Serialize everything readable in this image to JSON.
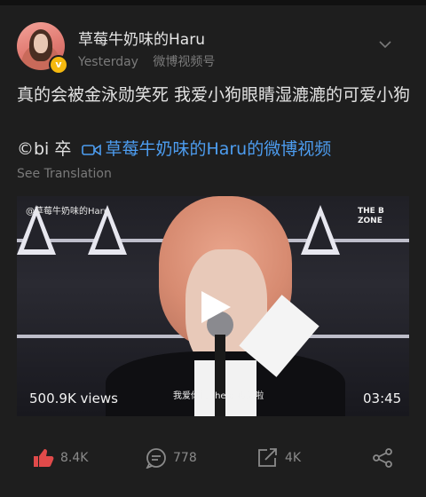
{
  "post": {
    "username": "草莓牛奶味的Haru",
    "time": "Yesterday",
    "source": "微博视频号",
    "text": "真的会被金泳勋笑死 我爱小狗眼睛湿漉漉的可爱小狗",
    "credit_prefix": "©bi 卒",
    "credit_link": "草莓牛奶味的Haru的微博视频",
    "translate_label": "See Translation"
  },
  "video": {
    "watermark": "@草莓牛奶味的Haru",
    "channel_logo": "THE B ZONE",
    "subtitle": "我爱你们 the b 再见啦",
    "views": "500.9K views",
    "duration": "03:45"
  },
  "actions": {
    "likes": "8.4K",
    "comments": "778",
    "reposts": "4K"
  },
  "colors": {
    "background": "#1e1e1e",
    "link": "#4d9df0",
    "like_red": "#e04a4a",
    "verified": "#f5b90f"
  },
  "icons": [
    "chevron-down-icon",
    "video-link-icon",
    "play-icon",
    "like-icon",
    "comment-icon",
    "repost-icon",
    "share-icon"
  ]
}
